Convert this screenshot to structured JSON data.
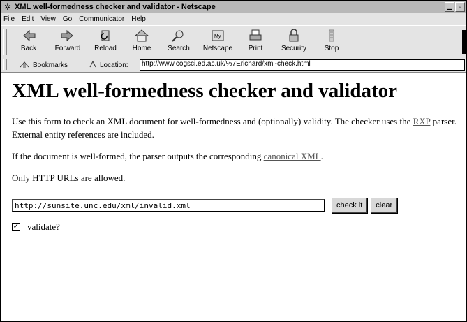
{
  "window": {
    "title": "XML well-formedness checker and validator - Netscape",
    "icon": "netscape-logo-icon"
  },
  "menu": [
    "File",
    "Edit",
    "View",
    "Go",
    "Communicator",
    "Help"
  ],
  "toolbar": {
    "buttons": [
      {
        "label": "Back",
        "icon": "back-arrow-icon"
      },
      {
        "label": "Forward",
        "icon": "forward-arrow-icon"
      },
      {
        "label": "Reload",
        "icon": "reload-icon"
      },
      {
        "label": "Home",
        "icon": "home-icon"
      },
      {
        "label": "Search",
        "icon": "search-icon"
      },
      {
        "label": "Netscape",
        "icon": "netscape-icon"
      },
      {
        "label": "Print",
        "icon": "print-icon"
      },
      {
        "label": "Security",
        "icon": "security-lock-icon"
      },
      {
        "label": "Stop",
        "icon": "stop-icon"
      }
    ]
  },
  "location_bar": {
    "bookmarks_label": "Bookmarks",
    "location_label": "Location:",
    "url": "http://www.cogsci.ed.ac.uk/%7Erichard/xml-check.html"
  },
  "page": {
    "heading": "XML well-formedness checker and validator",
    "para1_before": "Use this form to check an XML document for well-formedness and (optionally) validity. The checker uses the ",
    "para1_link": "RXP",
    "para1_after": " parser. External entity references are included.",
    "para2_before": "If the document is well-formed, the parser outputs the corresponding ",
    "para2_link": "canonical XML",
    "para2_after": ".",
    "para3": "Only HTTP URLs are allowed.",
    "form": {
      "url_value": "http://sunsite.unc.edu/xml/invalid.xml",
      "check_label": "check it",
      "clear_label": "clear",
      "validate_label": "validate?",
      "validate_checked": true
    }
  }
}
